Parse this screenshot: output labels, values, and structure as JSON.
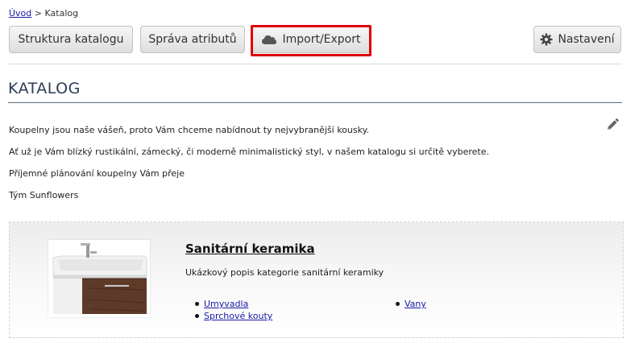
{
  "breadcrumb": {
    "home": "Úvod",
    "separator": ">",
    "current": "Katalog"
  },
  "toolbar": {
    "structure_label": "Struktura katalogu",
    "attributes_label": "Správa atributů",
    "import_export_label": "Import/Export",
    "settings_label": "Nastavení"
  },
  "page": {
    "title": "KATALOG"
  },
  "intro": {
    "line1": "Koupelny jsou naše vášeň, proto Vám chceme nabídnout ty nejvybranější kousky.",
    "line2": "Ať už je Vám blízký rustikální, zámecký, či moderně minimalistický styl, v našem katalogu si určitě vyberete.",
    "line3": "Příjemné plánování koupelny Vám přeje",
    "line4": "Tým Sunflowers"
  },
  "category": {
    "title": "Sanitární keramika",
    "description": "Ukázkový popis kategorie sanitární keramiky",
    "subcategories": [
      "Umyvadla",
      "Sprchové kouty",
      "Vany"
    ]
  },
  "icons": {
    "import_export": "cloud-icon",
    "settings": "gear-icon",
    "edit": "pencil-icon"
  },
  "colors": {
    "highlight": "#e00000",
    "heading": "#2b3d54",
    "link": "#1a1aa6"
  }
}
